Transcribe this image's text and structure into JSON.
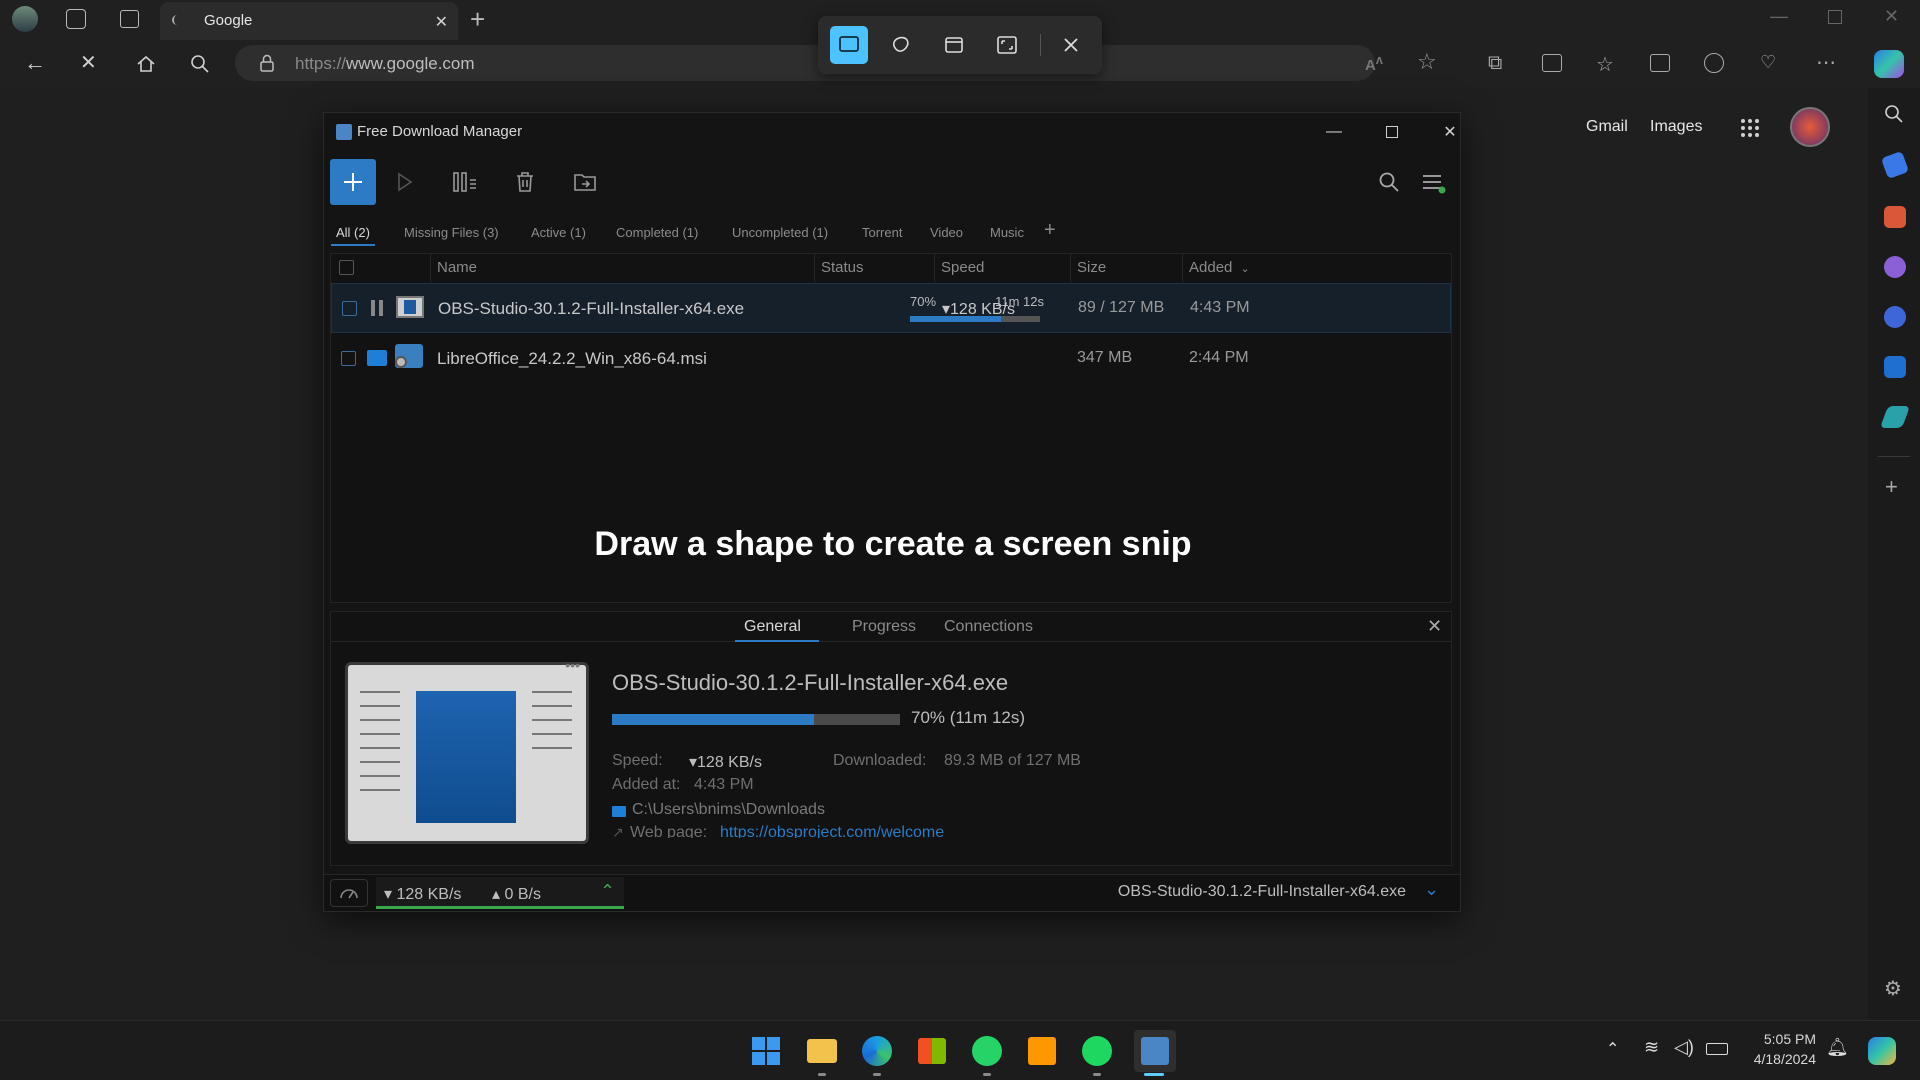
{
  "browser": {
    "tab_title": "Google",
    "url_prefix": "https://",
    "url_host": "www.google.com",
    "google_links": [
      "Gmail",
      "Images"
    ]
  },
  "snip_toolbar": {
    "modes": [
      "rectangle-snip-icon",
      "freeform-snip-icon",
      "window-snip-icon",
      "fullscreen-snip-icon",
      "close-icon"
    ],
    "active_mode": "rectangle"
  },
  "fdm": {
    "title": "Free Download Manager",
    "filters": [
      "All (2)",
      "Missing Files (3)",
      "Active (1)",
      "Completed (1)",
      "Uncompleted (1)",
      "Torrent",
      "Video",
      "Music"
    ],
    "columns": [
      "Name",
      "Status",
      "Speed",
      "Size",
      "Added"
    ],
    "rows": [
      {
        "name": "OBS-Studio-30.1.2-Full-Installer-x64.exe",
        "status_pct": "70%",
        "status_time": "11m 12s",
        "progress": 0.7,
        "speed": "▾128 KB/s",
        "size": "89 / 127 MB",
        "added": "4:43 PM"
      },
      {
        "name": "LibreOffice_24.2.2_Win_x86-64.msi",
        "status_pct": "",
        "status_time": "",
        "progress": 0,
        "speed": "",
        "size": "347 MB",
        "added": "2:44 PM"
      }
    ],
    "overlay_message": "Draw a shape to create a screen snip",
    "details": {
      "tabs": [
        "General",
        "Progress",
        "Connections"
      ],
      "file_name": "OBS-Studio-30.1.2-Full-Installer-x64.exe",
      "progress": 0.7,
      "progress_text": "70% (11m 12s)",
      "speed_label": "Speed:",
      "speed_value": "▾128 KB/s",
      "downloaded_label": "Downloaded:",
      "downloaded_value": "89.3 MB of 127 MB",
      "added_label": "Added at:",
      "added_value": "4:43 PM",
      "folder": "C:\\Users\\bnims\\Downloads",
      "webpage_label": "Web page:",
      "webpage_url": "https://obsproject.com/welcome"
    },
    "status_bar": {
      "down_speed": "▾ 128 KB/s",
      "up_speed": "▴ 0 B/s",
      "current_file": "OBS-Studio-30.1.2-Full-Installer-x64.exe"
    }
  },
  "taskbar": {
    "time": "5:05 PM",
    "date": "4/18/2024"
  },
  "colors": {
    "accent": "#2c7bc4",
    "snip_active": "#4cc2ff",
    "speed_ok": "#3aa84a"
  }
}
